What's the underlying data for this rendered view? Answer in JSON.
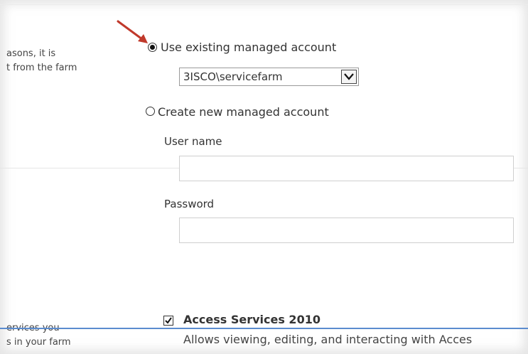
{
  "left_column": {
    "line1": "asons, it is",
    "line2": "t from the farm",
    "line3": "ervices you",
    "line4": "s in your farm"
  },
  "account": {
    "existing_label": "Use existing managed account",
    "existing_selected": true,
    "selected_account": "3ISCO\\servicefarm",
    "create_label": "Create new managed account",
    "create_selected": false,
    "username_label": "User name",
    "username_value": "",
    "password_label": "Password",
    "password_value": ""
  },
  "service": {
    "checked": true,
    "title": "Access Services 2010",
    "description": "Allows viewing, editing, and interacting with Acces"
  },
  "colors": {
    "annotation_arrow": "#c0392b",
    "bottom_rule": "#5b8ccf"
  }
}
